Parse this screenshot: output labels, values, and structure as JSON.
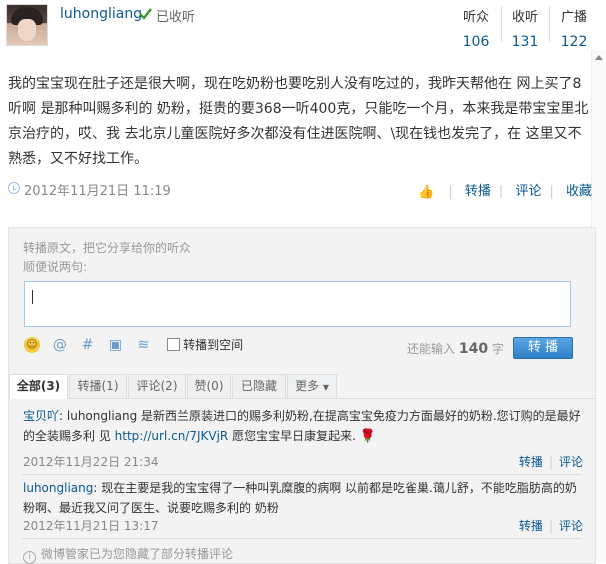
{
  "user": {
    "name": "luhongliang",
    "follow_status": "已收听"
  },
  "stats": [
    {
      "label": "听众",
      "value": "106"
    },
    {
      "label": "收听",
      "value": "131"
    },
    {
      "label": "广播",
      "value": "122"
    }
  ],
  "post": {
    "text": "我的宝宝现在肚子还是很大啊，现在吃奶粉也要吃别人没有吃过的，我昨天帮他在 网上买了8听啊 是那种叫赐多利的 奶粉，挺贵的要368一听400克，只能吃一个月，本来我是带宝宝里北京治疗的，哎、我 去北京儿童医院好多次都没有住进医院啊、\\现在钱也发完了，在 这里又不熟悉，又不好找工作。",
    "time": "2012年11月21日 11:19",
    "actions": {
      "repost": "转播",
      "comment": "评论",
      "favorite": "收藏"
    }
  },
  "composer": {
    "repost_hint": "转播原文，把它分享给你的听众",
    "say_hint": "顺便说两句:",
    "share_label": "转播到空间",
    "remain_prefix": "还能输入",
    "remain_count": "140",
    "remain_suffix": "字",
    "submit_label": "转 播"
  },
  "tabs": [
    {
      "label": "全部(3)",
      "active": true
    },
    {
      "label": "转播(1)"
    },
    {
      "label": "评论(2)"
    },
    {
      "label": "赞(0)"
    },
    {
      "label": "已隐藏"
    },
    {
      "label": "更多"
    }
  ],
  "comments": [
    {
      "author": "宝贝吖",
      "text_pre": ": luhongliang 是新西兰原装进口的赐多利奶粉,在提高宝宝免疫力方面最好的奶粉.您订购的是最好的全装赐多利 见 ",
      "link": "http://url.cn/7JKVjR",
      "text_post": " 愿您宝宝早日康复起来.",
      "time": "2012年11月22日 21:34",
      "repost": "转播",
      "comment": "评论"
    },
    {
      "author": "luhongliang",
      "text_pre": ": 现在主要是我的宝宝得了一种叫乳糜腹的病啊 以前都是吃雀巢.蔼儿舒，不能吃脂肪高的奶粉啊、最近我又问了医生、说要吃赐多利的 奶粉",
      "link": "",
      "text_post": "",
      "time": "2012年11月21日 13:17",
      "repost": "转播",
      "comment": "评论"
    }
  ],
  "hidden_note": "微博管家已为您隐藏了部分转播评论",
  "colors": {
    "link": "#0a5a92",
    "button": "#2d7fc7",
    "muted": "#888888"
  }
}
